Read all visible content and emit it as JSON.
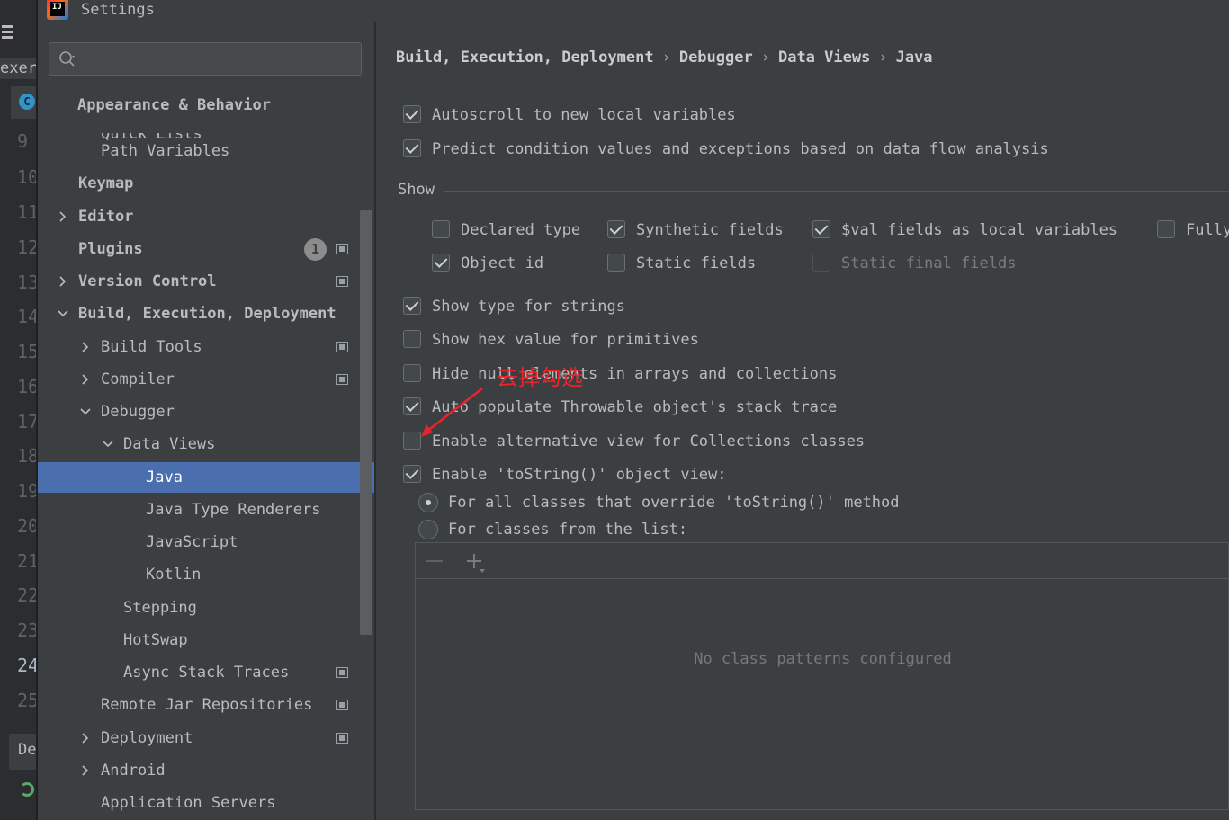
{
  "window": {
    "title": "Settings"
  },
  "ide_background": {
    "project_label": "exer",
    "bottom_label": "De",
    "line_numbers": [
      "9",
      "10",
      "11",
      "12",
      "13",
      "14",
      "15",
      "16",
      "17",
      "18",
      "19",
      "20",
      "21",
      "22",
      "23",
      "24",
      "25"
    ],
    "active_line": "24",
    "tab_icon_letter": "C"
  },
  "search": {
    "placeholder": "",
    "value": ""
  },
  "tree": {
    "ghost_item": "Quick Lists",
    "items": [
      {
        "label": "Appearance & Behavior",
        "bold": true
      },
      {
        "label": "Path Variables"
      },
      {
        "label": "Keymap",
        "bold": true
      },
      {
        "label": "Editor",
        "bold": true
      },
      {
        "label": "Plugins",
        "bold": true,
        "badge": "1"
      },
      {
        "label": "Version Control",
        "bold": true
      },
      {
        "label": "Build, Execution, Deployment",
        "bold": true
      },
      {
        "label": "Build Tools"
      },
      {
        "label": "Compiler"
      },
      {
        "label": "Debugger"
      },
      {
        "label": "Data Views"
      },
      {
        "label": "Java",
        "selected": true
      },
      {
        "label": "Java Type Renderers"
      },
      {
        "label": "JavaScript"
      },
      {
        "label": "Kotlin"
      },
      {
        "label": "Stepping"
      },
      {
        "label": "HotSwap"
      },
      {
        "label": "Async Stack Traces"
      },
      {
        "label": "Remote Jar Repositories"
      },
      {
        "label": "Deployment"
      },
      {
        "label": "Android"
      },
      {
        "label": "Application Servers"
      }
    ]
  },
  "breadcrumb": {
    "items": [
      "Build, Execution, Deployment",
      "Debugger",
      "Data Views",
      "Java"
    ],
    "separator": "›"
  },
  "options": {
    "autoscroll": {
      "label": "Autoscroll to new local variables",
      "checked": true
    },
    "predict": {
      "label": "Predict condition values and exceptions based on data flow analysis",
      "checked": true
    },
    "show_section": "Show",
    "declared_type": {
      "label": "Declared type",
      "checked": false
    },
    "synthetic_fields": {
      "label": "Synthetic fields",
      "checked": true
    },
    "val_fields": {
      "label": "$val fields as local variables",
      "checked": true
    },
    "fully": {
      "label": "Fully",
      "checked": false
    },
    "object_id": {
      "label": "Object id",
      "checked": true
    },
    "static_fields": {
      "label": "Static fields",
      "checked": false
    },
    "static_final_fields": {
      "label": "Static final fields",
      "checked": false,
      "disabled": true
    },
    "type_for_strings": {
      "label": "Show type for strings",
      "checked": true
    },
    "hex_value": {
      "label": "Show hex value for primitives",
      "checked": false
    },
    "hide_null": {
      "label": "Hide null elements in arrays and collections",
      "checked": false
    },
    "auto_populate": {
      "label": "Auto populate Throwable object's stack trace",
      "checked": true
    },
    "alt_view": {
      "label": "Enable alternative view for Collections classes",
      "checked": false
    },
    "tostring_view": {
      "label": "Enable 'toString()' object view:",
      "checked": true
    },
    "radio_all": {
      "label": "For all classes that override 'toString()' method",
      "selected": true
    },
    "radio_list": {
      "label": "For classes from the list:",
      "selected": false
    }
  },
  "pattern_list": {
    "empty_text": "No class patterns configured"
  },
  "annotation": {
    "text": "去掉勾选",
    "color": "#e8242d"
  },
  "colors": {
    "selection": "#4b6eaf",
    "panel": "#3c3f41",
    "accent_red": "#e8242d"
  }
}
